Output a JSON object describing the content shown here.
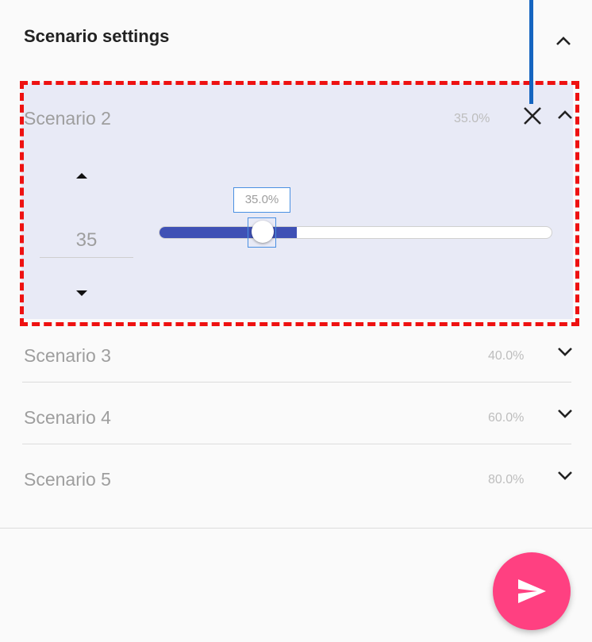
{
  "header": {
    "title": "Scenario settings",
    "collapse_icon": "chevron-up-icon"
  },
  "active_scenario": {
    "name": "Scenario 2",
    "percent_label": "35.0%",
    "close_icon": "close-icon",
    "collapse_icon": "chevron-up-icon",
    "stepper": {
      "value": "35",
      "up_icon": "triangle-up-icon",
      "down_icon": "triangle-down-icon"
    },
    "slider": {
      "value_fraction": 0.35,
      "tooltip": "35.0%"
    }
  },
  "scenarios": [
    {
      "name": "Scenario 3",
      "percent_label": "40.0%",
      "expand_icon": "chevron-down-icon"
    },
    {
      "name": "Scenario 4",
      "percent_label": "60.0%",
      "expand_icon": "chevron-down-icon"
    },
    {
      "name": "Scenario 5",
      "percent_label": "80.0%",
      "expand_icon": "chevron-down-icon"
    }
  ],
  "fab": {
    "icon": "send-icon"
  },
  "colors": {
    "accent": "#3f51b5",
    "fab": "#ff4081",
    "highlight_outline": "#ee1111",
    "annotation_pointer": "#1565c0",
    "expanded_background": "#e8eaf6"
  }
}
